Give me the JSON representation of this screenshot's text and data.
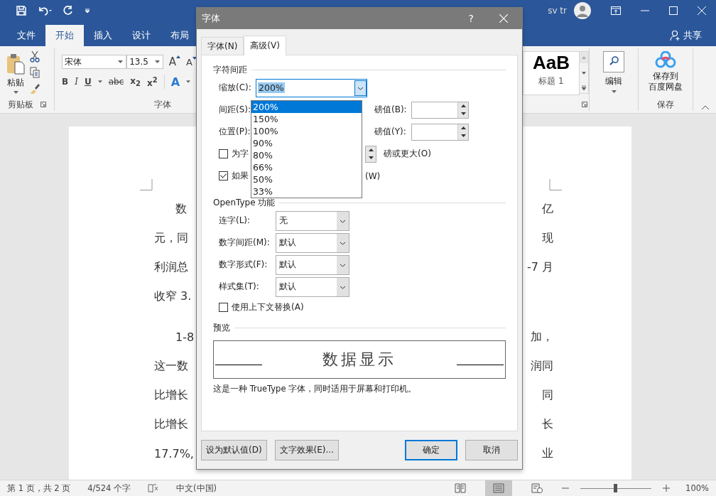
{
  "title_bar": {
    "user": "sv tr"
  },
  "ribbon_tabs": [
    {
      "label": "文件",
      "selected": false
    },
    {
      "label": "开始",
      "selected": true
    },
    {
      "label": "插入",
      "selected": false
    },
    {
      "label": "设计",
      "selected": false
    },
    {
      "label": "布局",
      "selected": false
    }
  ],
  "share": "共享",
  "ribbon": {
    "paste": "粘贴",
    "clipboard_group": "剪贴板",
    "font_name": "宋体",
    "font_size": "13.5",
    "grow_font": "A",
    "shrink_font": "A",
    "format_buttons": [
      "B",
      "I",
      "U",
      "abc",
      "x$_{2}$",
      "x$^{2}$"
    ],
    "text_effect": "A",
    "font_group": "字体",
    "style_preview": "AaB",
    "style_name": "标题 1",
    "edit": "编辑",
    "save_to": [
      "保存到",
      "百度网盘"
    ],
    "save_group": "保存"
  },
  "document": {
    "paragraphs": [
      {
        "lines": [
          {
            "left": "数",
            "right": "亿"
          },
          {
            "left": "元，同",
            "right": "现"
          },
          {
            "left": "利润总",
            "right": "-7 月"
          },
          {
            "left": "收窄 3."
          }
        ]
      },
      {
        "lines": [
          {
            "left": "1-8",
            "right": "加，"
          },
          {
            "left": "这一数",
            "right": "润同"
          },
          {
            "left": "比增长",
            "right": "同"
          },
          {
            "left": "比增长",
            "right": "长"
          },
          {
            "left": "17.7%,",
            "right": "业"
          }
        ]
      }
    ]
  },
  "dialog": {
    "title": "字体",
    "help": "?",
    "tabs": [
      {
        "label": "字体(N)",
        "selected": false
      },
      {
        "label": "高级(V)",
        "selected": true
      }
    ],
    "spacing_section": "字符间距",
    "scale": {
      "label": "缩放(C):",
      "value": "200%",
      "expanded": true,
      "options": [
        {
          "label": "200%",
          "selected": true
        },
        {
          "label": "150%",
          "selected": false
        },
        {
          "label": "100%",
          "selected": false
        },
        {
          "label": "90%",
          "selected": false
        },
        {
          "label": "80%",
          "selected": false
        },
        {
          "label": "66%",
          "selected": false
        },
        {
          "label": "50%",
          "selected": false
        },
        {
          "label": "33%",
          "selected": false
        }
      ]
    },
    "spacing": {
      "label": "间距(S):",
      "points_label": "磅值(B):"
    },
    "position": {
      "label": "位置(P):",
      "points_label": "磅值(Y):"
    },
    "kerning": {
      "label": "为字",
      "checked": false,
      "suffix": "磅或更大(O)"
    },
    "grid": {
      "label": "如果",
      "checked": true,
      "suffix": "(W)"
    },
    "opentype_section": "OpenType 功能",
    "selects": [
      {
        "label": "连字(L):",
        "value": "无"
      },
      {
        "label": "数字间距(M):",
        "value": "默认"
      },
      {
        "label": "数字形式(F):",
        "value": "默认"
      },
      {
        "label": "样式集(T):",
        "value": "默认"
      }
    ],
    "contextual": {
      "label": "使用上下文替换(A)",
      "checked": false
    },
    "preview_section": "预览",
    "preview_text": "数据显示",
    "preview_note": "这是一种 TrueType 字体，同时适用于屏幕和打印机。",
    "buttons": [
      {
        "label": "设为默认值(D)",
        "default": false
      },
      {
        "label": "文字效果(E)...",
        "default": false
      },
      {
        "label": "确定",
        "default": true
      },
      {
        "label": "取消",
        "default": false
      }
    ]
  },
  "status_bar": {
    "items": [
      "第 1 页，共 2 页",
      "4/524 个字",
      "中文(中国)"
    ],
    "views": [
      {
        "kind": "read",
        "selected": false
      },
      {
        "kind": "print",
        "selected": true
      },
      {
        "kind": "web",
        "selected": false
      }
    ],
    "zoom": {
      "level": 0.5,
      "reading": "100%"
    }
  }
}
